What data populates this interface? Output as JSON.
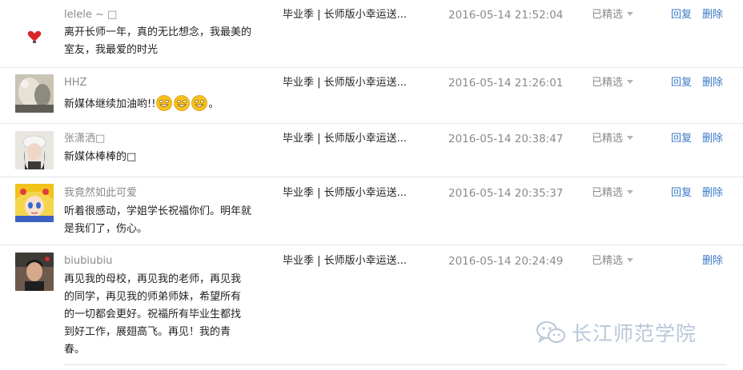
{
  "comments": [
    {
      "nickname": "lelele ~ □",
      "content": "离开长师一年，真的无比想念，我最美的室友，我最爱的时光",
      "article": "毕业季 | 长师版小幸运送...",
      "time": "2016-05-14 21:52:04",
      "status": "已精选",
      "reply": "回复",
      "delete": "删除",
      "avatar": "red-heart-avatar"
    },
    {
      "nickname": "HHZ",
      "content": "新媒体继续加油哟!!",
      "content_suffix": "。",
      "emojis": [
        "grin-emoji",
        "grin-emoji",
        "grin-emoji"
      ],
      "article": "毕业季 | 长师版小幸运送...",
      "time": "2016-05-14 21:26:01",
      "status": "已精选",
      "reply": "回复",
      "delete": "删除",
      "avatar": "vintage-photo-avatar"
    },
    {
      "nickname": "张潇洒□",
      "content": "新媒体棒棒的□",
      "article": "毕业季 | 长师版小幸运送...",
      "time": "2016-05-14 20:38:47",
      "status": "已精选",
      "reply": "回复",
      "delete": "删除",
      "avatar": "girl-cap-avatar"
    },
    {
      "nickname": "我竟然如此可爱",
      "content": "听着很感动，学姐学长祝福你们。明年就是我们了，伤心。",
      "article": "毕业季 | 长师版小幸运送...",
      "time": "2016-05-14 20:35:37",
      "status": "已精选",
      "reply": "回复",
      "delete": "删除",
      "avatar": "anime-avatar"
    },
    {
      "nickname": "biubiubiu",
      "content": "再见我的母校，再见我的老师，再见我的同学，再见我的师弟师妹，希望所有的一切都会更好。祝福所有毕业生都找到好工作，展翅高飞。再见！我的青春。",
      "article": "毕业季 | 长师版小幸运送...",
      "time": "2016-05-14 20:24:49",
      "status": "已精选",
      "reply": "",
      "delete": "删除",
      "avatar": "boy-selfie-avatar"
    }
  ],
  "watermark": {
    "text": "长江师范学院",
    "icon": "wechat-icon"
  },
  "colors": {
    "link": "#3b7bc8",
    "muted": "#8a8a8a",
    "text": "#222222",
    "divider": "#e4e4e4"
  }
}
